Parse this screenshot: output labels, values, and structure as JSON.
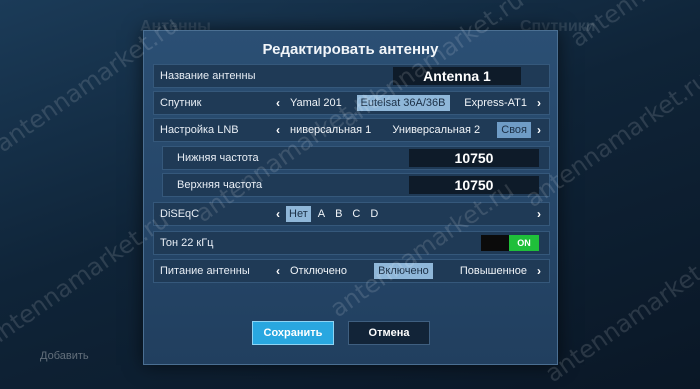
{
  "background": {
    "left_label": "Антенны",
    "right_label": "Спутники",
    "add_label": "Добавить"
  },
  "dialog": {
    "title": "Редактировать антенну",
    "antenna_name": {
      "label": "Название антенны",
      "value": "Antenna 1"
    },
    "satellite": {
      "label": "Спутник",
      "options": [
        "Yamal 201",
        "Eutelsat 36A/36B",
        "Express-AT1"
      ],
      "selected_index": 1
    },
    "lnb": {
      "label": "Настройка LNB",
      "options": [
        "ниверсальная 1",
        "Универсальная 2",
        "Своя"
      ],
      "selected_index": 2
    },
    "lower_freq": {
      "label": "Нижняя частота",
      "value": "10750"
    },
    "upper_freq": {
      "label": "Верхняя частота",
      "value": "10750"
    },
    "diseqc": {
      "label": "DiSEqC",
      "options": [
        "Нет",
        "A",
        "B",
        "C",
        "D"
      ],
      "selected_index": 0
    },
    "tone": {
      "label": "Тон 22 кГц",
      "state": "ON"
    },
    "power": {
      "label": "Питание антенны",
      "options": [
        "Отключено",
        "Включено",
        "Повышенное"
      ],
      "selected_index": 1
    },
    "buttons": {
      "save": "Сохранить",
      "cancel": "Отмена"
    }
  },
  "watermark": "antennamarket.ru"
}
